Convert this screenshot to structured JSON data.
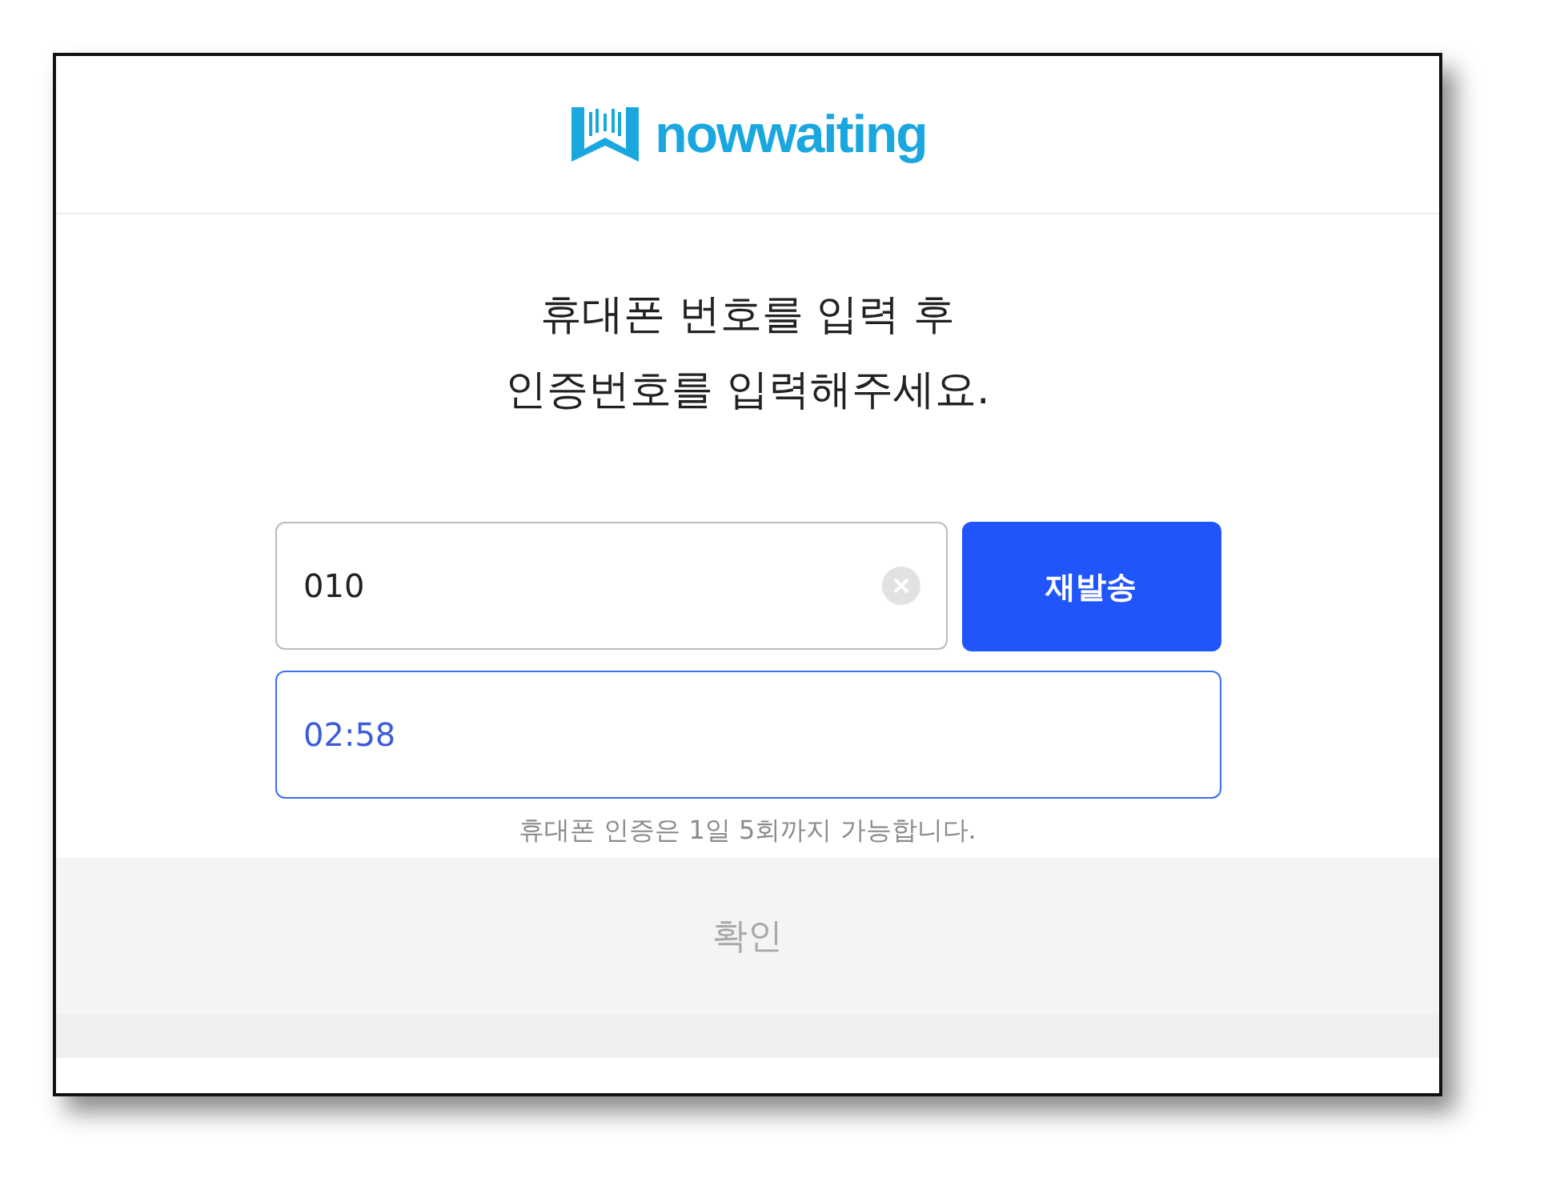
{
  "logo": {
    "text": "nowwaiting"
  },
  "title": [
    "휴대폰 번호를 입력 후",
    "인증번호를 입력해주세요."
  ],
  "phone_field": {
    "value": "010"
  },
  "resend_button": {
    "label": "재발송"
  },
  "code_field": {
    "value": "02:58",
    "focused": true
  },
  "note": "휴대폰 인증은 1일 5회까지 가능합니다.",
  "confirm_button": {
    "label": "확인",
    "disabled": true
  }
}
